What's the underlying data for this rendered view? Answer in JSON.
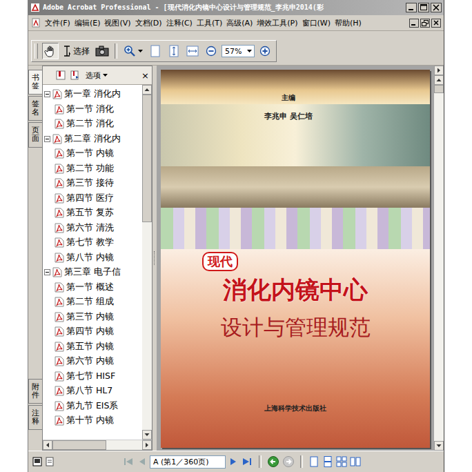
{
  "window": {
    "title": "Adobe Acrobat Professional - [现代消化内镜中心设计与管理规范_李兆申2014(彩"
  },
  "menu": [
    "文件(F)",
    "编辑(E)",
    "视图(V)",
    "文档(D)",
    "注释(C)",
    "工具(T)",
    "高级(A)",
    "增效工具(P)",
    "窗口(W)",
    "帮助(H)"
  ],
  "toolbar": {
    "select_label": "选择",
    "zoom": "57%"
  },
  "side_tabs": [
    {
      "label": "书签",
      "selected": true,
      "group": "top"
    },
    {
      "label": "签名",
      "selected": false,
      "group": "top"
    },
    {
      "label": "页面",
      "selected": false,
      "group": "top"
    },
    {
      "label": "附件",
      "selected": false,
      "group": "bottom"
    },
    {
      "label": "注释",
      "selected": false,
      "group": "bottom"
    }
  ],
  "panel": {
    "options": "选项",
    "close": "×"
  },
  "bookmarks": [
    {
      "text": "第一章 消化内",
      "kind": "chapter",
      "expanded": true
    },
    {
      "text": "第一节 消化",
      "kind": "section",
      "expanded": false
    },
    {
      "text": "第二节 消化",
      "kind": "section",
      "expanded": false
    },
    {
      "text": "第二章 消化内",
      "kind": "chapter",
      "expanded": true
    },
    {
      "text": "第一节 内镜",
      "kind": "section",
      "expanded": false
    },
    {
      "text": "第二节 功能",
      "kind": "section",
      "expanded": false
    },
    {
      "text": "第三节 接待",
      "kind": "section",
      "expanded": false
    },
    {
      "text": "第四节 医疗",
      "kind": "section",
      "expanded": false
    },
    {
      "text": "第五节 复苏",
      "kind": "section",
      "expanded": false
    },
    {
      "text": "第六节 清洗",
      "kind": "section",
      "expanded": false
    },
    {
      "text": "第七节 教学",
      "kind": "section",
      "expanded": false
    },
    {
      "text": "第八节 内镜",
      "kind": "section",
      "expanded": false
    },
    {
      "text": "第三章 电子信",
      "kind": "chapter",
      "expanded": true
    },
    {
      "text": "第一节 概述",
      "kind": "section",
      "expanded": false
    },
    {
      "text": "第二节 组成",
      "kind": "section",
      "expanded": false
    },
    {
      "text": "第三节 内镜",
      "kind": "section",
      "expanded": false
    },
    {
      "text": "第四节 内镜",
      "kind": "section",
      "expanded": false
    },
    {
      "text": "第五节 内镜",
      "kind": "section",
      "expanded": false
    },
    {
      "text": "第六节 内镜",
      "kind": "section",
      "expanded": false
    },
    {
      "text": "第七节 HISF",
      "kind": "section",
      "expanded": false
    },
    {
      "text": "第八节 HL7",
      "kind": "section",
      "expanded": false
    },
    {
      "text": "第九节 EIS系",
      "kind": "section",
      "expanded": false
    },
    {
      "text": "第十节 内镜",
      "kind": "section",
      "expanded": false
    }
  ],
  "cover": {
    "editor_label": "主编",
    "editors": "李兆申 吴仁培",
    "badge": "现代",
    "title": "消化内镜中心",
    "subtitle": "设计与管理规范",
    "publisher": "上海科学技术出版社"
  },
  "status": {
    "page_field": "A (第1／360页)"
  }
}
